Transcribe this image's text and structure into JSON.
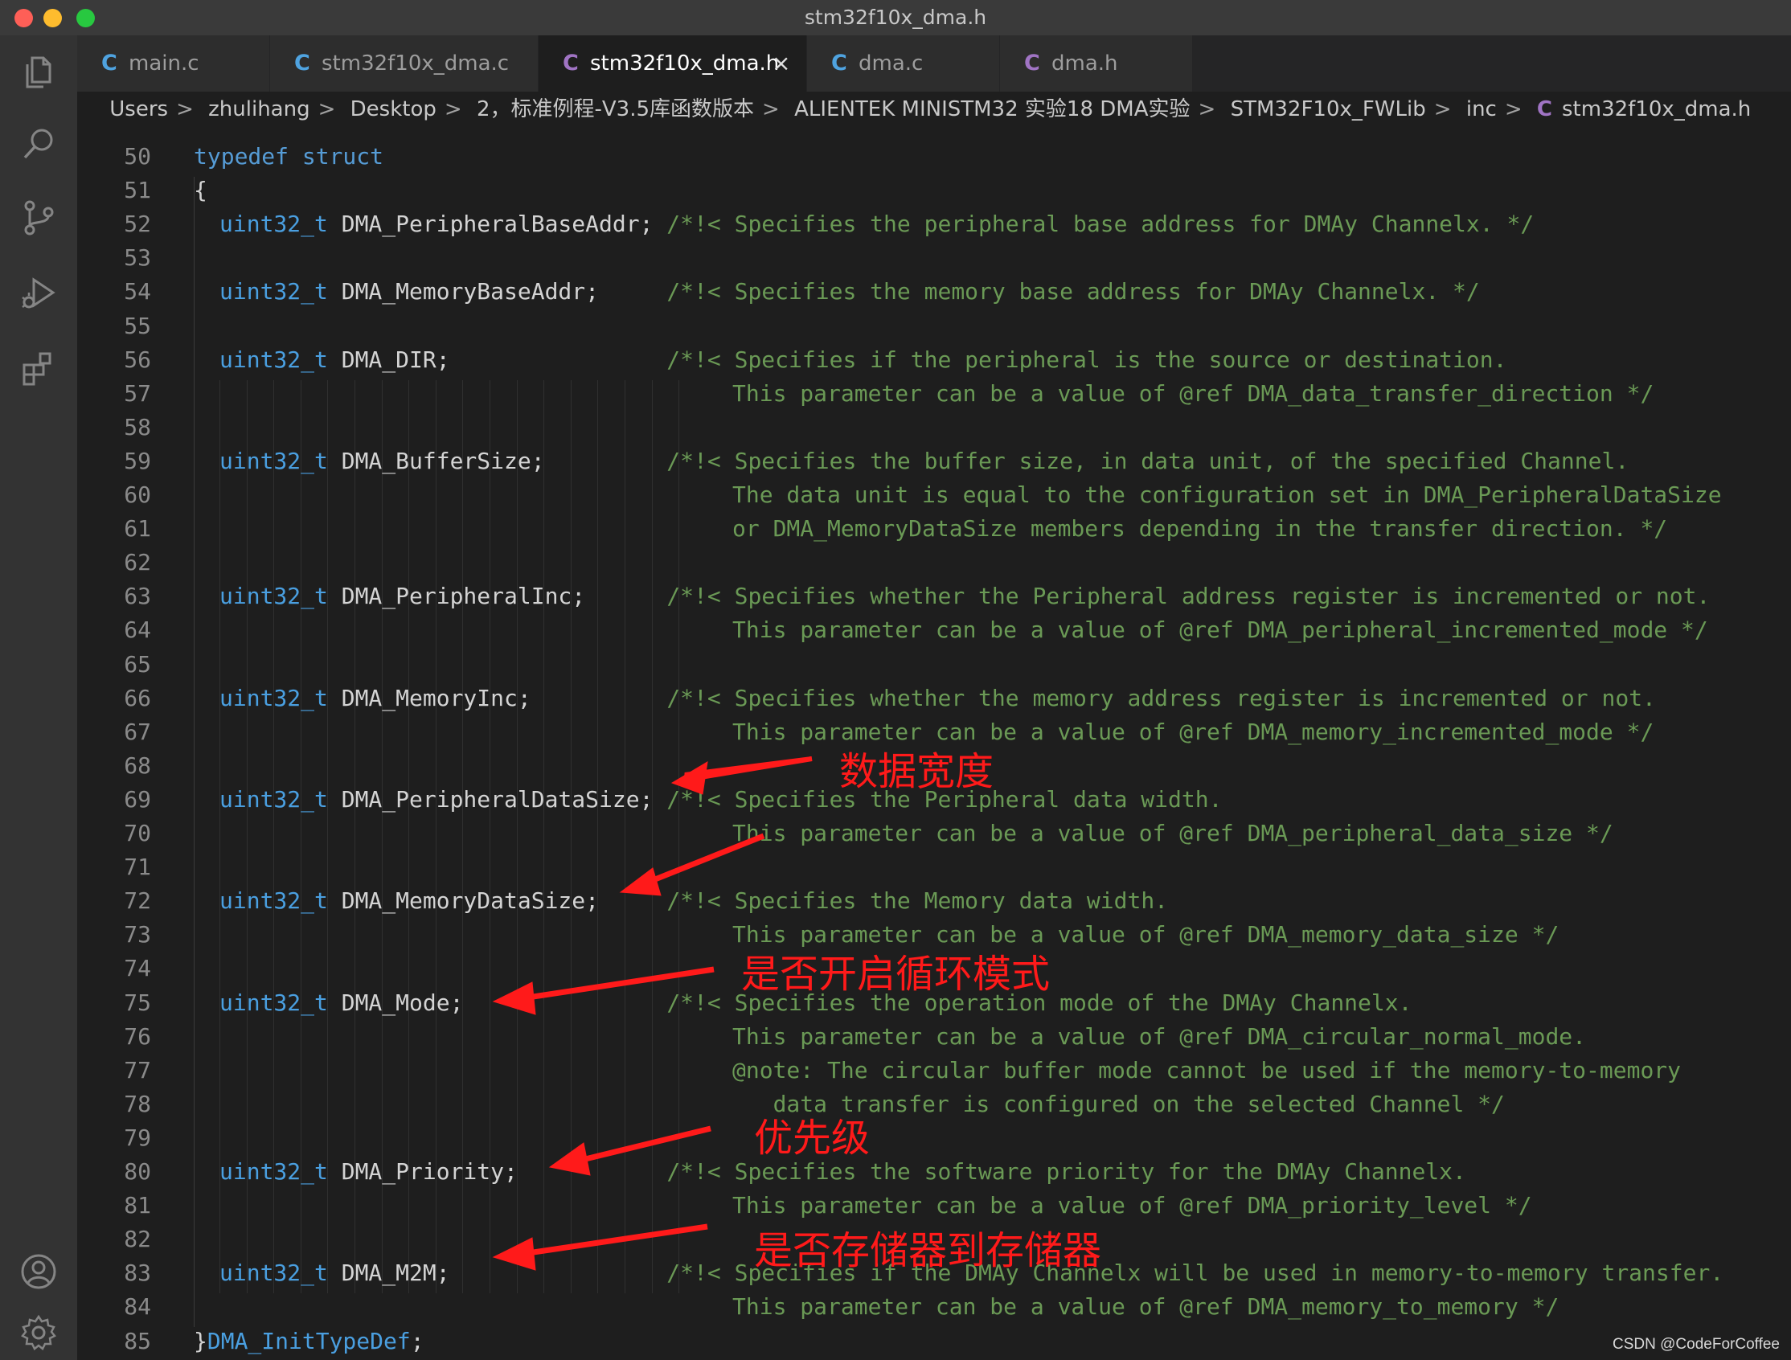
{
  "window": {
    "title": "stm32f10x_dma.h"
  },
  "colors": {
    "close_light": "#fe5f57",
    "minimize_light": "#febc2e",
    "maximize_light": "#28c840",
    "c_icon": "#4fa3e0",
    "c_icon_active": "#a074c4",
    "annotation": "#ff1a1a"
  },
  "activity_bar": [
    {
      "name": "explorer-icon"
    },
    {
      "name": "search-icon"
    },
    {
      "name": "source-control-icon"
    },
    {
      "name": "run-debug-icon"
    },
    {
      "name": "extensions-icon"
    },
    {
      "name": "accounts-icon"
    },
    {
      "name": "settings-gear-icon"
    }
  ],
  "tabs": [
    {
      "icon": "C",
      "label": "main.c",
      "active": false
    },
    {
      "icon": "C",
      "label": "stm32f10x_dma.c",
      "active": false
    },
    {
      "icon": "C",
      "label": "stm32f10x_dma.h",
      "active": true,
      "close": "×"
    },
    {
      "icon": "C",
      "label": "dma.c",
      "active": false
    },
    {
      "icon": "C",
      "label": "dma.h",
      "active": false
    }
  ],
  "breadcrumb": {
    "items": [
      "Users",
      "zhulihang",
      "Desktop",
      "2，标准例程-V3.5库函数版本",
      "ALIENTEK MINISTM32 实验18 DMA实验",
      "STM32F10x_FWLib",
      "inc"
    ],
    "file_icon": "C",
    "file": "stm32f10x_dma.h",
    "separator": ">"
  },
  "code": {
    "lines": [
      {
        "num": "50",
        "kw": "typedef struct",
        "decl": "",
        "comment": ""
      },
      {
        "num": "51",
        "text": "{"
      },
      {
        "num": "52",
        "type": "uint32_t",
        "decl": " DMA_PeripheralBaseAddr;",
        "pad": " ",
        "comment": "/*!< Specifies the peripheral base address for DMAy Channelx. */"
      },
      {
        "num": "53"
      },
      {
        "num": "54",
        "type": "uint32_t",
        "decl": " DMA_MemoryBaseAddr;",
        "pad": "     ",
        "comment": "/*!< Specifies the memory base address for DMAy Channelx. */"
      },
      {
        "num": "55"
      },
      {
        "num": "56",
        "type": "uint32_t",
        "decl": " DMA_DIR;",
        "pad": "                ",
        "comment": "/*!< Specifies if the peripheral is the source or destination."
      },
      {
        "num": "57",
        "cont": "This parameter can be a value of @ref DMA_data_transfer_direction */"
      },
      {
        "num": "58"
      },
      {
        "num": "59",
        "type": "uint32_t",
        "decl": " DMA_BufferSize;",
        "pad": "         ",
        "comment": "/*!< Specifies the buffer size, in data unit, of the specified Channel."
      },
      {
        "num": "60",
        "cont": "The data unit is equal to the configuration set in DMA_PeripheralDataSize"
      },
      {
        "num": "61",
        "cont": "or DMA_MemoryDataSize members depending in the transfer direction. */"
      },
      {
        "num": "62"
      },
      {
        "num": "63",
        "type": "uint32_t",
        "decl": " DMA_PeripheralInc;",
        "pad": "      ",
        "comment": "/*!< Specifies whether the Peripheral address register is incremented or not."
      },
      {
        "num": "64",
        "cont": "This parameter can be a value of @ref DMA_peripheral_incremented_mode */"
      },
      {
        "num": "65"
      },
      {
        "num": "66",
        "type": "uint32_t",
        "decl": " DMA_MemoryInc;",
        "pad": "          ",
        "comment": "/*!< Specifies whether the memory address register is incremented or not."
      },
      {
        "num": "67",
        "cont": "This parameter can be a value of @ref DMA_memory_incremented_mode */"
      },
      {
        "num": "68"
      },
      {
        "num": "69",
        "type": "uint32_t",
        "decl": " DMA_PeripheralDataSize;",
        "pad": " ",
        "comment": "/*!< Specifies the Peripheral data width."
      },
      {
        "num": "70",
        "cont": "This parameter can be a value of @ref DMA_peripheral_data_size */"
      },
      {
        "num": "71"
      },
      {
        "num": "72",
        "type": "uint32_t",
        "decl": " DMA_MemoryDataSize;",
        "pad": "     ",
        "comment": "/*!< Specifies the Memory data width."
      },
      {
        "num": "73",
        "cont": "This parameter can be a value of @ref DMA_memory_data_size */"
      },
      {
        "num": "74"
      },
      {
        "num": "75",
        "type": "uint32_t",
        "decl": " DMA_Mode;",
        "pad": "               ",
        "comment": "/*!< Specifies the operation mode of the DMAy Channelx."
      },
      {
        "num": "76",
        "cont": "This parameter can be a value of @ref DMA_circular_normal_mode."
      },
      {
        "num": "77",
        "cont": "@note: The circular buffer mode cannot be used if the memory-to-memory"
      },
      {
        "num": "78",
        "cont": "   data transfer is configured on the selected Channel */"
      },
      {
        "num": "79"
      },
      {
        "num": "80",
        "type": "uint32_t",
        "decl": " DMA_Priority;",
        "pad": "           ",
        "comment": "/*!< Specifies the software priority for the DMAy Channelx."
      },
      {
        "num": "81",
        "cont": "This parameter can be a value of @ref DMA_priority_level */"
      },
      {
        "num": "82"
      },
      {
        "num": "83",
        "type": "uint32_t",
        "decl": " DMA_M2M;",
        "pad": "                ",
        "comment": "/*!< Specifies if the DMAy Channelx will be used in memory-to-memory transfer."
      },
      {
        "num": "84",
        "cont": "This parameter can be a value of @ref DMA_memory_to_memory */"
      },
      {
        "num": "85",
        "close": "}",
        "typename": "DMA_InitTypeDef",
        "semi": ";"
      }
    ]
  },
  "annotations": [
    {
      "text": "数据宽度",
      "points_to": "DMA_PeripheralDataSize"
    },
    {
      "text": "是否开启循环模式",
      "points_to": "DMA_Mode"
    },
    {
      "text": "优先级",
      "points_to": "DMA_Priority"
    },
    {
      "text": "是否存储器到存储器",
      "points_to": "DMA_M2M"
    }
  ],
  "watermark": "CSDN @CodeForCoffee"
}
